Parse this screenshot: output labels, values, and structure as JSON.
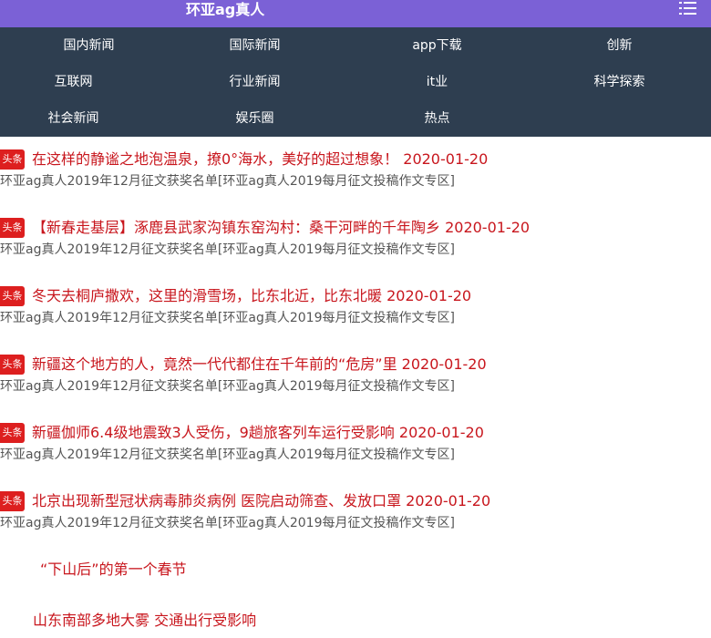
{
  "header": {
    "site_title": "环亚ag真人",
    "menu_icon": "list-menu-icon",
    "background_color": "#7b61d6"
  },
  "nav": {
    "background_color": "#2e3e50",
    "items": [
      {
        "label": "国内新闻"
      },
      {
        "label": "国际新闻"
      },
      {
        "label": "app下载"
      },
      {
        "label": "创新"
      },
      {
        "label": "互联网"
      },
      {
        "label": "行业新闻"
      },
      {
        "label": "it业"
      },
      {
        "label": "科学探索"
      },
      {
        "label": "社会新闻"
      },
      {
        "label": "娱乐圈"
      },
      {
        "label": "热点"
      }
    ]
  },
  "news": {
    "badge_color": "#dd1f1f",
    "headline_color": "#c8161d",
    "items": [
      {
        "badge": "头条",
        "title": "在这样的静谧之地泡温泉，撩0°海水，美好的超过想象！ 2020-01-20",
        "link1": "环亚ag真人2019年12月征文获奖名单",
        "link2": "[环亚ag真人2019每月征文投稿作文专区]"
      },
      {
        "badge": "头条",
        "title": "【新春走基层】涿鹿县武家沟镇东窑沟村：桑干河畔的千年陶乡 2020-01-20",
        "link1": "环亚ag真人2019年12月征文获奖名单",
        "link2": "[环亚ag真人2019每月征文投稿作文专区]"
      },
      {
        "badge": "头条",
        "title": "冬天去桐庐撒欢，这里的滑雪场，比东北近，比东北暖 2020-01-20",
        "link1": "环亚ag真人2019年12月征文获奖名单",
        "link2": "[环亚ag真人2019每月征文投稿作文专区]"
      },
      {
        "badge": "头条",
        "title": "新疆这个地方的人，竟然一代代都住在千年前的“危房”里 2020-01-20",
        "link1": "环亚ag真人2019年12月征文获奖名单",
        "link2": "[环亚ag真人2019每月征文投稿作文专区]"
      },
      {
        "badge": "头条",
        "title": "新疆伽师6.4级地震致3人受伤，9趟旅客列车运行受影响 2020-01-20",
        "link1": "环亚ag真人2019年12月征文获奖名单",
        "link2": "[环亚ag真人2019每月征文投稿作文专区]"
      },
      {
        "badge": "头条",
        "title": "北京出现新型冠状病毒肺炎病例 医院启动筛查、发放口罩 2020-01-20",
        "link1": "环亚ag真人2019年12月征文获奖名单",
        "link2": "[环亚ag真人2019每月征文投稿作文专区]"
      }
    ]
  },
  "extra_links": [
    {
      "label": "“下山后”的第一个春节"
    },
    {
      "label": "山东南部多地大雾 交通出行受影响"
    }
  ]
}
